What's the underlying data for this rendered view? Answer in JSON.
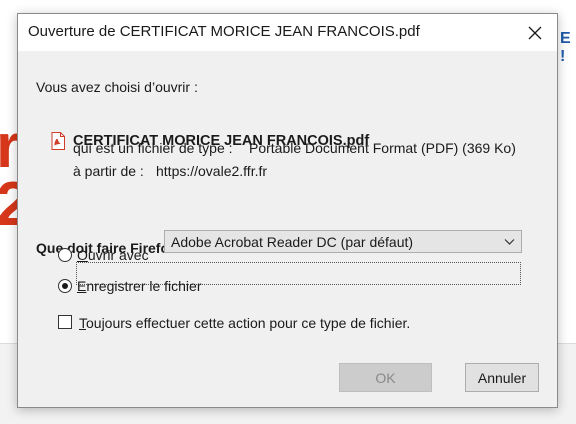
{
  "background": {
    "left_fragment": "r\n2(",
    "right_fragment": "E !"
  },
  "dialog": {
    "title": "Ouverture de CERTIFICAT MORICE JEAN FRANCOIS.pdf",
    "intro": "Vous avez choisi d’ouvrir :",
    "file_name": "CERTIFICAT MORICE JEAN FRANCOIS.pdf",
    "type_label": "qui est un fichier de type :",
    "type_value": "Portable Document Format (PDF) (369 Ko)",
    "source_label": "à partir de :",
    "source_value": "https://ovale2.ffr.fr",
    "question": "Que doit faire Firefox avec ce fichier ?",
    "open_with_label": "Ouvrir avec",
    "open_with_app": "Adobe Acrobat Reader DC (par défaut)",
    "save_label": "Enregistrer le fichier",
    "always_label": "Toujours effectuer cette action pour ce type de fichier.",
    "ok_label": "OK",
    "cancel_label": "Annuler",
    "selected_option": "save",
    "always_checked": false
  }
}
